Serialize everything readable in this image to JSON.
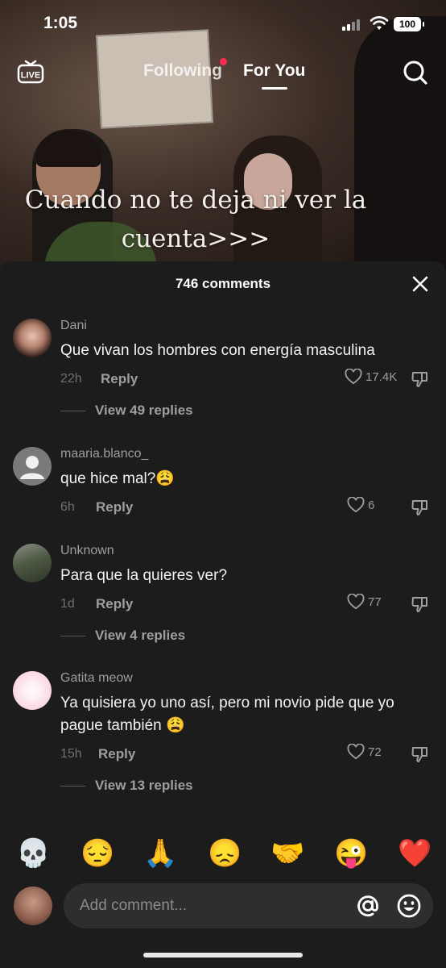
{
  "status_bar": {
    "time": "1:05",
    "battery": "100"
  },
  "top_nav": {
    "live_label": "LIVE",
    "tab_following": "Following",
    "tab_for_you": "For You"
  },
  "video": {
    "caption": "Cuando no te deja ni ver la cuenta>>>"
  },
  "comments_sheet": {
    "title": "746 comments",
    "reply_label": "Reply",
    "comments": [
      {
        "user": "Dani",
        "text": "Que vivan los hombres con energía masculina",
        "time": "22h",
        "likes": "17.4K",
        "view_replies": "View 49 replies"
      },
      {
        "user": "maaria.blanco_",
        "text": "que hice mal?😩",
        "time": "6h",
        "likes": "6"
      },
      {
        "user": "Unknown",
        "text": "Para que la quieres ver?",
        "time": "1d",
        "likes": "77",
        "view_replies": "View 4 replies"
      },
      {
        "user": "Gatita meow",
        "text": "Ya quisiera yo uno así, pero mi novio pide que yo pague también 😩",
        "time": "15h",
        "likes": "72",
        "view_replies": "View 13 replies"
      }
    ]
  },
  "quick_emojis": [
    "💀",
    "😔",
    "🙏",
    "😞",
    "🤝",
    "😜",
    "❤️"
  ],
  "comment_input": {
    "placeholder": "Add comment..."
  },
  "colors": {
    "accent": "#fe2c55",
    "sheet_bg": "#1c1c1c",
    "input_bg": "#2e2e2e"
  }
}
